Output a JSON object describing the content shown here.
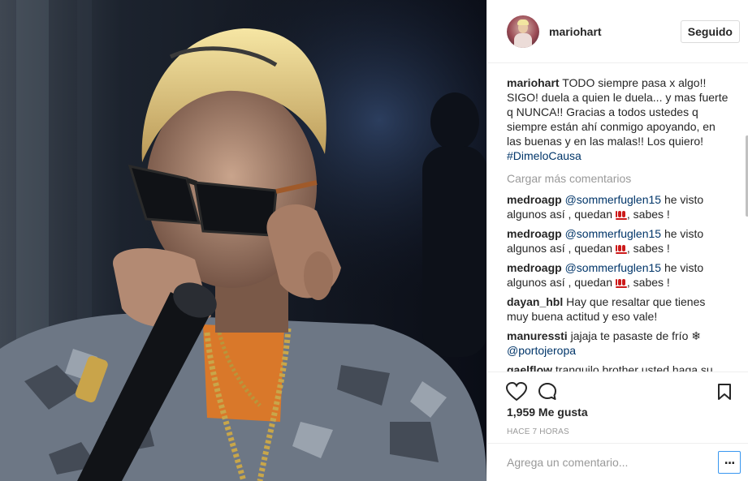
{
  "post": {
    "username": "mariohart",
    "follow_label": "Seguido",
    "caption": {
      "user": "mariohart",
      "text": "TODO siempre pasa x algo!! SIGO! duela a quien le duela... y mas fuerte q NUNCA!! Gracias a todos ustedes q siempre están ahí conmigo apoyando, en las buenas y en las malas!! Los quiero! ",
      "hashtag": "#DimeloCausa"
    },
    "load_more": "Cargar más comentarios",
    "comments": [
      {
        "user": "medroagp",
        "mention": "@sommerfuglen15",
        "text_a": " he visto algunos así , quedan ",
        "emoji": "100-emoji",
        "text_b": ", sabes !"
      },
      {
        "user": "medroagp",
        "mention": "@sommerfuglen15",
        "text_a": " he visto algunos así , quedan ",
        "emoji": "100-emoji",
        "text_b": ", sabes !"
      },
      {
        "user": "medroagp",
        "mention": "@sommerfuglen15",
        "text_a": " he visto algunos así , quedan ",
        "emoji": "100-emoji",
        "text_b": ", sabes !"
      },
      {
        "user": "dayan_hbl",
        "text": "Hay que resaltar que tienes muy buena actitud y eso vale!"
      },
      {
        "user": "manuressti",
        "text": "jajaja te pasaste de frío ❄",
        "mention": "@portojeropa"
      },
      {
        "user": "gaelflow",
        "text": "tranquilo brother usted haga su"
      }
    ],
    "likes": "1,959 Me gusta",
    "time": "HACE 7 HORAS",
    "add_comment_placeholder": "Agrega un comentario...",
    "more_label": "...",
    "icons": {
      "like": "heart-icon",
      "comment": "comment-bubble-icon",
      "save": "bookmark-icon",
      "more": "more-options-icon"
    }
  }
}
